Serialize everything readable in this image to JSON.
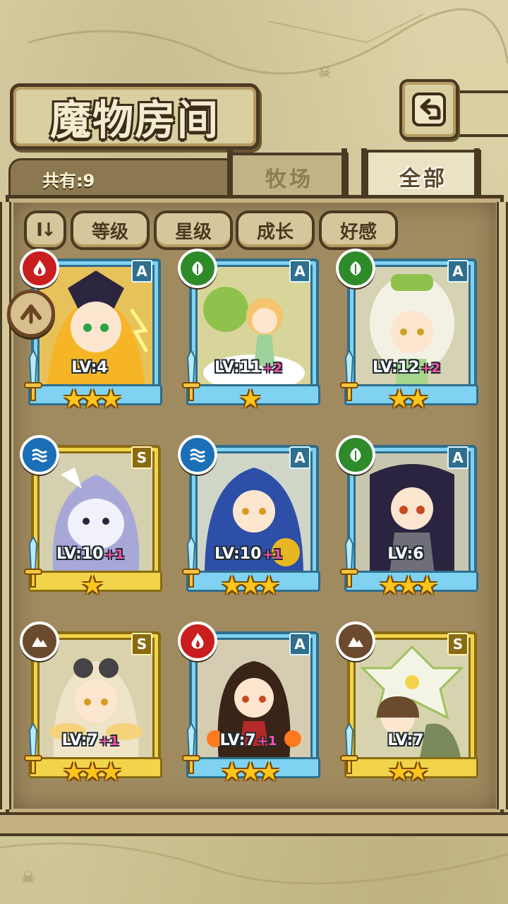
{
  "header": {
    "title": "魔物房间",
    "count_label": "共有:9"
  },
  "tabs": [
    {
      "label": "牧场",
      "active": false
    },
    {
      "label": "全部",
      "active": true
    }
  ],
  "filters": [
    "等级",
    "星级",
    "成长",
    "好感"
  ],
  "colors": {
    "blue_frame": "#7fd2f1",
    "gold_frame": "#f2d44b",
    "plus": "#ff4fa8",
    "star": "#ffc51c"
  },
  "monsters": [
    {
      "element": "fire-icon",
      "rank": "A",
      "level": "LV:4",
      "bonus": "",
      "stars": 3,
      "frame": "blue"
    },
    {
      "element": "leaf-icon",
      "rank": "A",
      "level": "LV:11",
      "bonus": "+2",
      "stars": 1,
      "frame": "blue"
    },
    {
      "element": "leaf-icon",
      "rank": "A",
      "level": "LV:12",
      "bonus": "+2",
      "stars": 2,
      "frame": "blue"
    },
    {
      "element": "water-icon",
      "rank": "S",
      "level": "LV:10",
      "bonus": "+1",
      "stars": 1,
      "frame": "gold"
    },
    {
      "element": "water-icon",
      "rank": "A",
      "level": "LV:10",
      "bonus": "+1",
      "stars": 3,
      "frame": "blue"
    },
    {
      "element": "leaf-icon",
      "rank": "A",
      "level": "LV:6",
      "bonus": "",
      "stars": 3,
      "frame": "blue"
    },
    {
      "element": "earth-icon",
      "rank": "S",
      "level": "LV:7",
      "bonus": "+1",
      "stars": 3,
      "frame": "gold"
    },
    {
      "element": "fire-icon",
      "rank": "A",
      "level": "LV:7",
      "bonus": "+1",
      "stars": 3,
      "frame": "blue"
    },
    {
      "element": "earth-icon",
      "rank": "S",
      "level": "LV:7",
      "bonus": "",
      "stars": 2,
      "frame": "gold"
    }
  ]
}
